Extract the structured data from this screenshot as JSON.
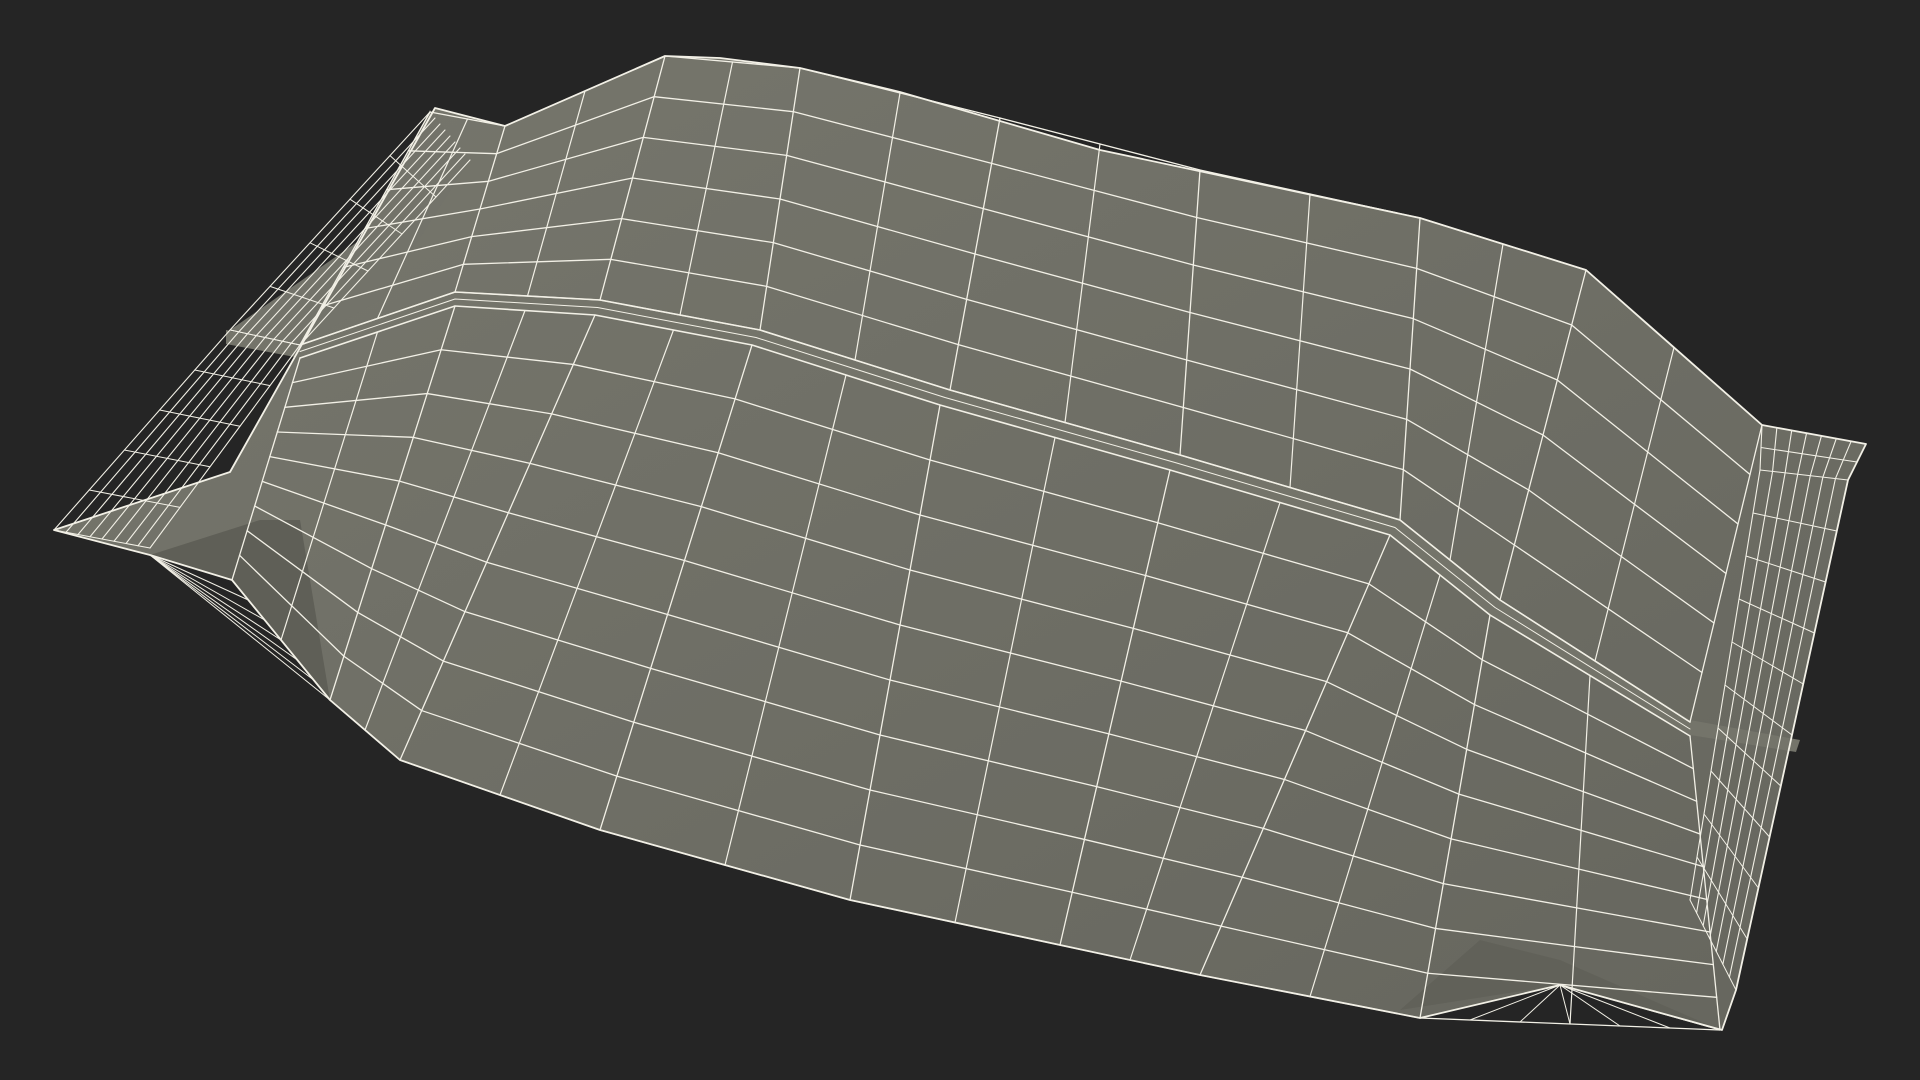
{
  "scene": {
    "subject": "pouch-bag-wireframe",
    "render_mode": "wireframe-on-shaded",
    "colors": {
      "background": "#252525",
      "surface": "#6f6f66",
      "surface_light": "#7a7a70",
      "surface_dark": "#5e5e56",
      "wire": "#f2f0e6"
    }
  }
}
